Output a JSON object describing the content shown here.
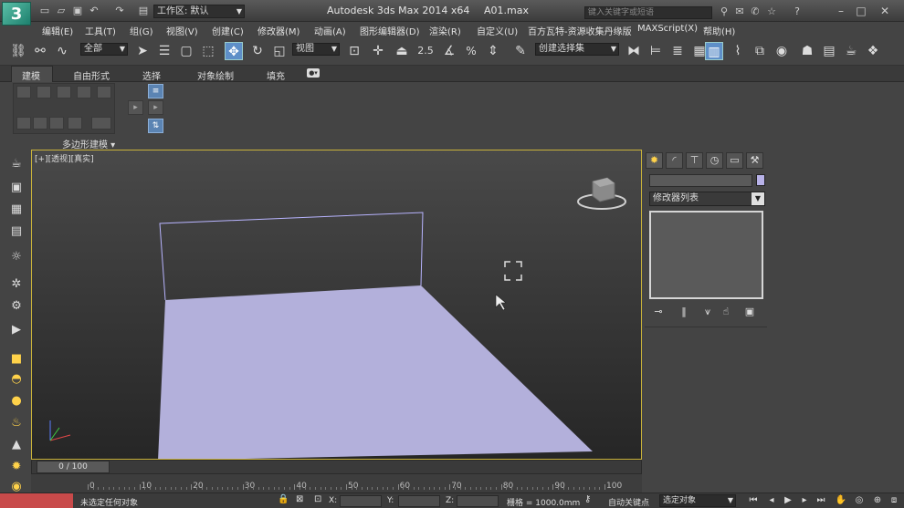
{
  "titlebar": {
    "logo": "3",
    "workspace_label": "工作区: 默认",
    "app_title": "Autodesk 3ds Max  2014 x64",
    "file_name": "A01.max",
    "search_placeholder": "键入关键字或短语"
  },
  "menu": [
    "编辑(E)",
    "工具(T)",
    "组(G)",
    "视图(V)",
    "创建(C)",
    "修改器(M)",
    "动画(A)",
    "图形编辑器(D)",
    "渲染(R)",
    "自定义(U)",
    "百方瓦特-资源收集丹缘版",
    "MAXScript(X)",
    "帮助(H)"
  ],
  "toolbar": {
    "selection_filter": "全部",
    "ref_coord": "视图",
    "angle_snap": "2.5",
    "percent_snap": "%",
    "named_selection": "创建选择集"
  },
  "ribbon": {
    "tabs": [
      "建模",
      "自由形式",
      "选择",
      "对象绘制",
      "填充"
    ],
    "active_tab": "建模",
    "group_label": "多边形建模 ▾"
  },
  "viewport": {
    "label": "[+][透视][真实]",
    "accent_color": "#c9b23a",
    "plane_color": "#b3b0db"
  },
  "command_panel": {
    "modifier_list": "修改器列表",
    "swatch_color": "#b8b2e8"
  },
  "timeline": {
    "frame_display": "0 / 100",
    "ticks": [
      "0",
      "10",
      "20",
      "30",
      "40",
      "50",
      "60",
      "70",
      "80",
      "90",
      "100"
    ]
  },
  "status": {
    "message": "未选定任何对象",
    "x_label": "X:",
    "y_label": "Y:",
    "z_label": "Z:",
    "grid": "栅格 = 1000.0mm",
    "auto_key": "自动关键点",
    "selection_set": "选定对象"
  }
}
